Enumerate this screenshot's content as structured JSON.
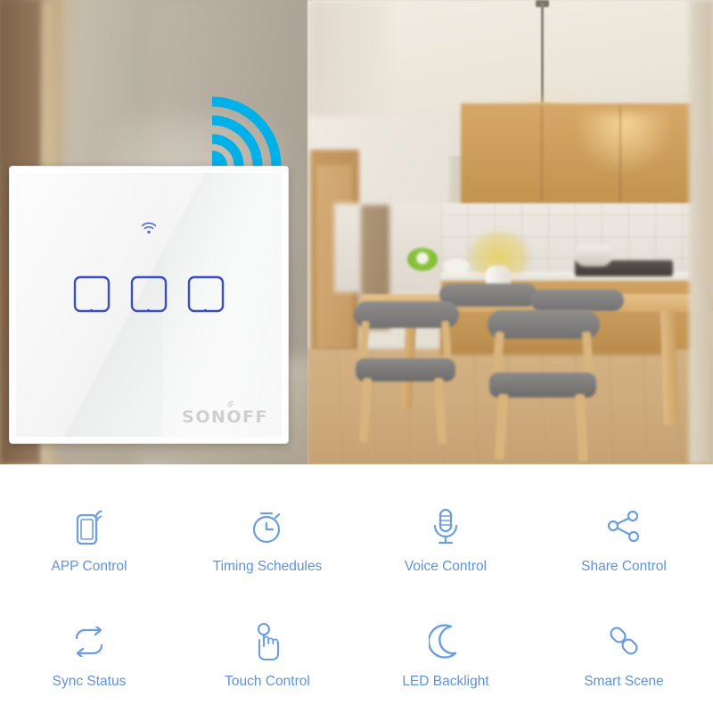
{
  "product": {
    "brand": "SONOFF",
    "panel_type": "3-gang wall touch switch",
    "wifi_indicator": "wifi-icon",
    "gang_count": 3,
    "colors": {
      "accent_cyan": "#00b0e8",
      "touch_key_blue": "#3a4fc4",
      "feature_blue": "#5f93d8",
      "logo_gray": "#cfcfcf"
    }
  },
  "hero": {
    "wifi_signal": "wifi-signal-graphic",
    "scene": "kitchen-dining-room-photo"
  },
  "features": {
    "items": [
      {
        "label": "APP Control",
        "icon": "phone-signal-icon"
      },
      {
        "label": "Timing Schedules",
        "icon": "stopwatch-icon"
      },
      {
        "label": "Voice Control",
        "icon": "microphone-icon"
      },
      {
        "label": "Share Control",
        "icon": "share-nodes-icon"
      },
      {
        "label": "Sync Status",
        "icon": "sync-arrows-icon"
      },
      {
        "label": "Touch Control",
        "icon": "hand-tap-icon"
      },
      {
        "label": "LED Backlight",
        "icon": "moon-icon"
      },
      {
        "label": "Smart Scene",
        "icon": "link-chain-icon"
      }
    ]
  }
}
